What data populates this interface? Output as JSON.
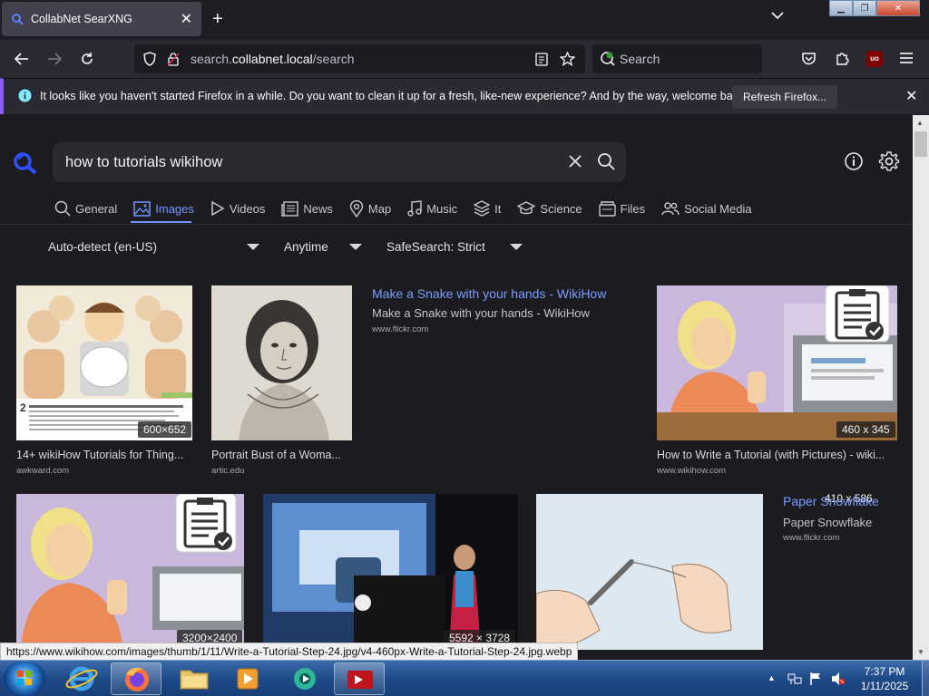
{
  "browser": {
    "tab_title": "CollabNet SearXNG",
    "url_prefix": "search.",
    "url_domain": "collabnet.local",
    "url_path": "/search",
    "search_placeholder": "Search",
    "notification": {
      "message": "It looks like you haven't started Firefox in a while. Do you want to clean it up for a fresh, like-new experience? And by the way, welcome back!",
      "button": "Refresh Firefox..."
    },
    "status_url": "https://www.wikihow.com/images/thumb/1/11/Write-a-Tutorial-Step-24.jpg/v4-460px-Write-a-Tutorial-Step-24.jpg.webp"
  },
  "search": {
    "query": "how to tutorials wikihow",
    "categories": [
      {
        "label": "General",
        "icon": "search-icon"
      },
      {
        "label": "Images",
        "icon": "image-icon",
        "active": true
      },
      {
        "label": "Videos",
        "icon": "play-icon"
      },
      {
        "label": "News",
        "icon": "news-icon"
      },
      {
        "label": "Map",
        "icon": "map-pin-icon"
      },
      {
        "label": "Music",
        "icon": "music-icon"
      },
      {
        "label": "It",
        "icon": "layers-icon"
      },
      {
        "label": "Science",
        "icon": "graduation-cap-icon"
      },
      {
        "label": "Files",
        "icon": "files-icon"
      },
      {
        "label": "Social Media",
        "icon": "people-icon"
      }
    ],
    "filters": {
      "language": "Auto-detect (en-US)",
      "time": "Anytime",
      "safesearch": "SafeSearch: Strict"
    }
  },
  "results": [
    {
      "title": "14+ wikiHow Tutorials for Thing...",
      "source": "awkward.com",
      "dims": "600×652"
    },
    {
      "title": "Portrait Bust of a Woma...",
      "source": "artic.edu"
    },
    {
      "title": "Make a Snake with your hands - WikiHow",
      "subtitle": "Make a Snake with your hands - WikiHow",
      "source": "www.flickr.com"
    },
    {
      "title": "How to Write a Tutorial (with Pictures) - wiki...",
      "source": "www.wikihow.com",
      "dims": "460 x 345"
    },
    {
      "dims": "3200×2400"
    },
    {
      "dims": "5592 × 3728"
    },
    {
      "dims": "410 x 586"
    },
    {
      "title": "Paper Snowflake",
      "subtitle": "Paper Snowflake",
      "source": "www.flickr.com"
    }
  ],
  "taskbar": {
    "time": "7:37 PM",
    "date": "1/11/2025"
  },
  "colors": {
    "accent": "#6f95ff",
    "page_bg": "#1c1c20",
    "notif_stripe": "#8b5cf6"
  }
}
